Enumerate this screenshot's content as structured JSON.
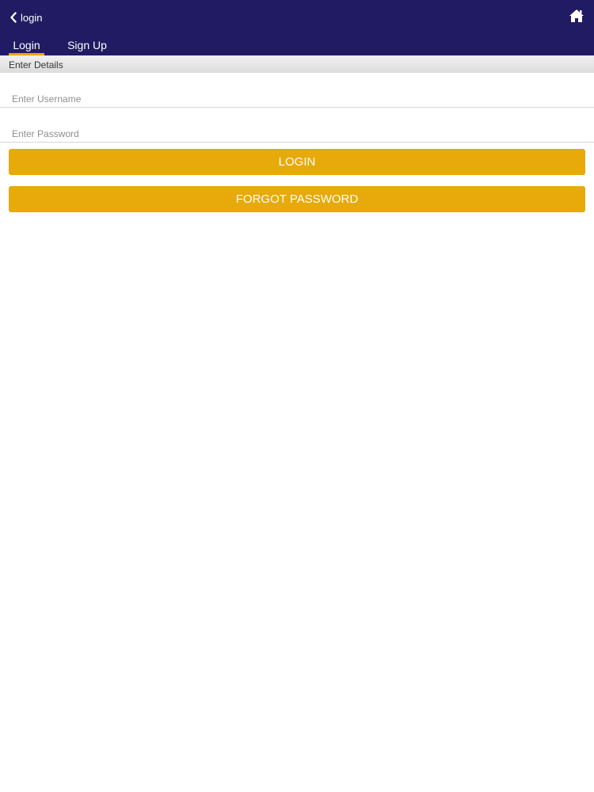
{
  "header": {
    "back_label": "login",
    "back_icon": "chevron-left-icon",
    "home_icon": "home-icon",
    "background_color": "#201b63"
  },
  "tabs": [
    {
      "label": "Login",
      "active": true
    },
    {
      "label": "Sign Up",
      "active": false
    }
  ],
  "form": {
    "section_title": "Enter Details",
    "username": {
      "value": "",
      "placeholder": "Enter Username"
    },
    "password": {
      "value": "",
      "placeholder": "Enter Password"
    },
    "login_button": "LOGIN",
    "forgot_button": "FORGOT PASSWORD"
  },
  "colors": {
    "accent": "#e8a90a",
    "header": "#201b63"
  }
}
